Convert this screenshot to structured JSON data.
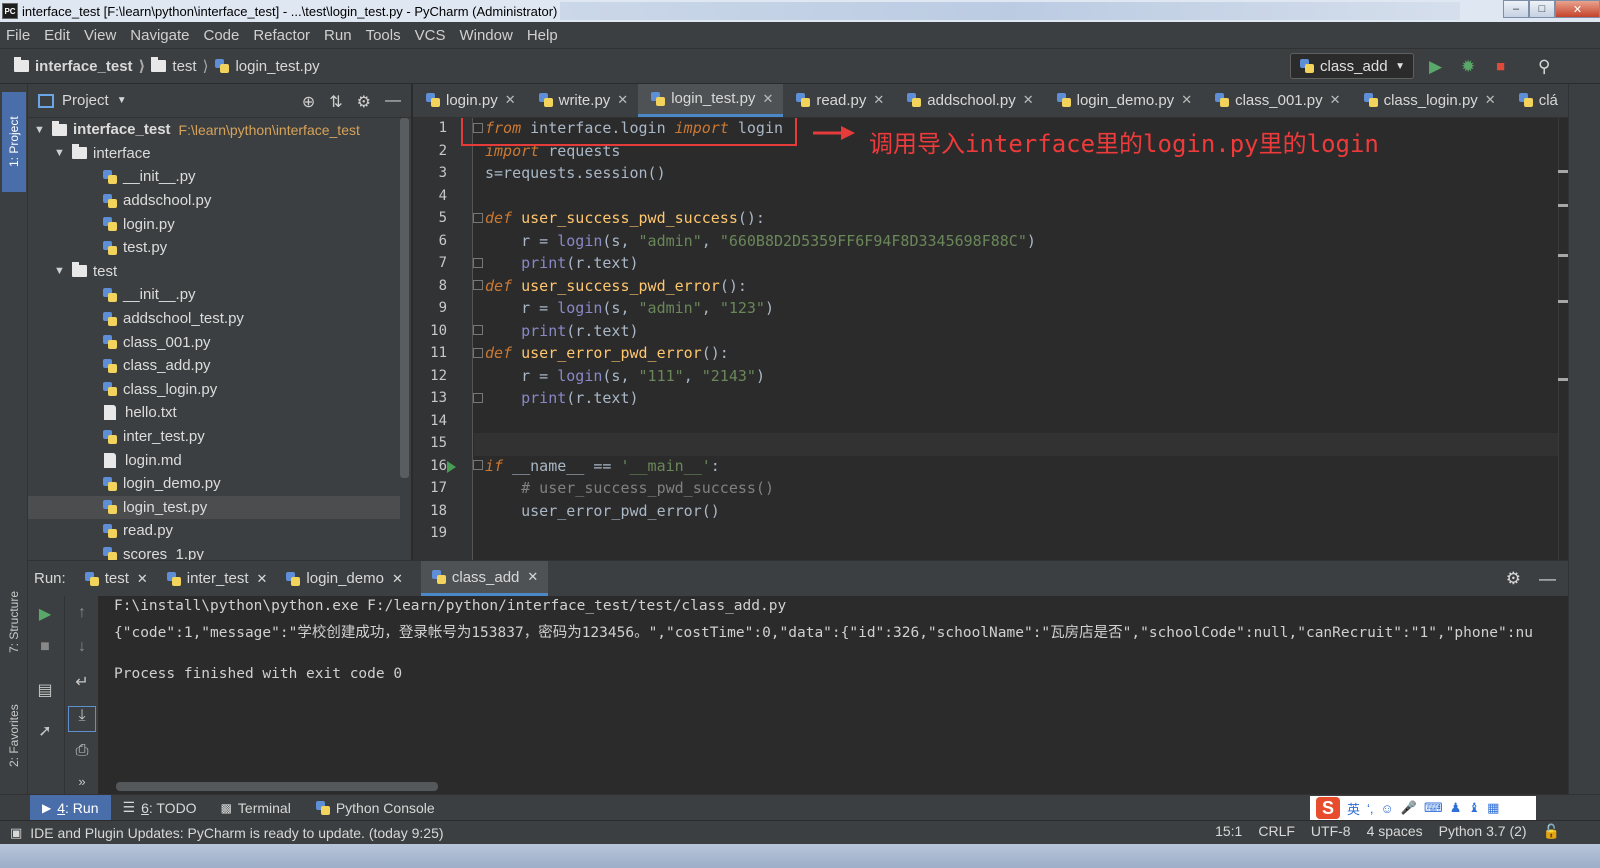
{
  "window": {
    "title": "interface_test [F:\\learn\\python\\interface_test] - ...\\test\\login_test.py - PyCharm (Administrator)",
    "app_icon": "PC",
    "minimize": "–",
    "maximize": "□",
    "close": "✕"
  },
  "menu": [
    "File",
    "Edit",
    "View",
    "Navigate",
    "Code",
    "Refactor",
    "Run",
    "Tools",
    "VCS",
    "Window",
    "Help"
  ],
  "breadcrumb": {
    "project": "interface_test",
    "folder": "test",
    "file": "login_test.py"
  },
  "run_config": "class_add",
  "project_panel": {
    "title": "Project",
    "root_name": "interface_test",
    "root_path": "F:\\learn\\python\\interface_test",
    "tree": [
      {
        "name": "interface",
        "type": "folder"
      },
      {
        "name": "__init__.py",
        "type": "py"
      },
      {
        "name": "addschool.py",
        "type": "py"
      },
      {
        "name": "login.py",
        "type": "py"
      },
      {
        "name": "test.py",
        "type": "py"
      },
      {
        "name": "test",
        "type": "folder"
      },
      {
        "name": "__init__.py",
        "type": "py"
      },
      {
        "name": "addschool_test.py",
        "type": "py"
      },
      {
        "name": "class_001.py",
        "type": "py"
      },
      {
        "name": "class_add.py",
        "type": "py"
      },
      {
        "name": "class_login.py",
        "type": "py"
      },
      {
        "name": "hello.txt",
        "type": "txt"
      },
      {
        "name": "inter_test.py",
        "type": "py"
      },
      {
        "name": "login.md",
        "type": "txt"
      },
      {
        "name": "login_demo.py",
        "type": "py"
      },
      {
        "name": "login_test.py",
        "type": "py",
        "selected": true
      },
      {
        "name": "read.py",
        "type": "py"
      },
      {
        "name": "scores_1.py",
        "type": "py"
      }
    ]
  },
  "editor_tabs": [
    "login.py",
    "write.py",
    "login_test.py",
    "read.py",
    "addschool.py",
    "login_demo.py",
    "class_001.py",
    "class_login.py",
    "clá"
  ],
  "active_tab": "login_test.py",
  "line_numbers": [
    "1",
    "2",
    "3",
    "4",
    "5",
    "6",
    "7",
    "8",
    "9",
    "10",
    "11",
    "12",
    "13",
    "14",
    "15",
    "16",
    "17",
    "18",
    "19"
  ],
  "code": {
    "l1_from": "from",
    "l1_mod": " interface.login ",
    "l1_import": "import",
    "l1_name": " login",
    "l2_import": "import",
    "l2_rest": " requests",
    "l3": "s=requests.session()",
    "l5_def": "def",
    "l5_name": " user_success_pwd_success",
    "l5_rest": "():",
    "l6_a": "    r = ",
    "l6_call": "login",
    "l6_b": "(s, ",
    "l6_s1": "\"admin\"",
    "l6_c": ", ",
    "l6_s2": "\"660B8D2D5359FF6F94F8D3345698F88C\"",
    "l6_d": ")",
    "l7_a": "    ",
    "l7_print": "print",
    "l7_b": "(r.text)",
    "l8_def": "def",
    "l8_name": " user_success_pwd_error",
    "l8_rest": "():",
    "l9_a": "    r = ",
    "l9_call": "login",
    "l9_b": "(s, ",
    "l9_s1": "\"admin\"",
    "l9_c": ", ",
    "l9_s2": "\"123\"",
    "l9_d": ")",
    "l10_a": "    ",
    "l10_print": "print",
    "l10_b": "(r.text)",
    "l11_def": "def",
    "l11_name": " user_error_pwd_error",
    "l11_rest": "():",
    "l12_a": "    r = ",
    "l12_call": "login",
    "l12_b": "(s, ",
    "l12_s1": "\"111\"",
    "l12_c": ", ",
    "l12_s2": "\"2143\"",
    "l12_d": ")",
    "l13_a": "    ",
    "l13_print": "print",
    "l13_b": "(r.text)",
    "l16_if": "if",
    "l16_a": " __name__ == ",
    "l16_s": "'__main__'",
    "l16_b": ":",
    "l17": "    # user_success_pwd_success()",
    "l18": "    user_error_pwd_error()"
  },
  "annotation": "调用导入interface里的login.py里的login",
  "run_panel": {
    "label": "Run:",
    "tabs": [
      "test",
      "inter_test",
      "login_demo",
      "class_add"
    ],
    "active_tab": "class_add",
    "console": [
      "F:\\install\\python\\python.exe F:/learn/python/interface_test/test/class_add.py",
      "{\"code\":1,\"message\":\"学校创建成功，登录帐号为153837，密码为123456。\",\"costTime\":0,\"data\":{\"id\":326,\"schoolName\":\"瓦房店是否\",\"schoolCode\":null,\"canRecruit\":\"1\",\"phone\":nu",
      "",
      "Process finished with exit code 0"
    ]
  },
  "left_strip": {
    "project": "1: Project",
    "structure": "7: Structure",
    "favorites": "2: Favorites"
  },
  "bottom_tabs": {
    "run_num": "4",
    "run_label": ": Run",
    "todo_num": "6",
    "todo_label": ": TODO",
    "terminal": "Terminal",
    "python_console": "Python Console"
  },
  "ime": {
    "logo": "S",
    "lang": "英"
  },
  "status": {
    "message": "IDE and Plugin Updates: PyCharm is ready to update. (today 9:25)",
    "position": "15:1",
    "line_sep": "CRLF",
    "encoding": "UTF-8",
    "indent": "4 spaces",
    "interpreter": "Python 3.7 (2)"
  }
}
